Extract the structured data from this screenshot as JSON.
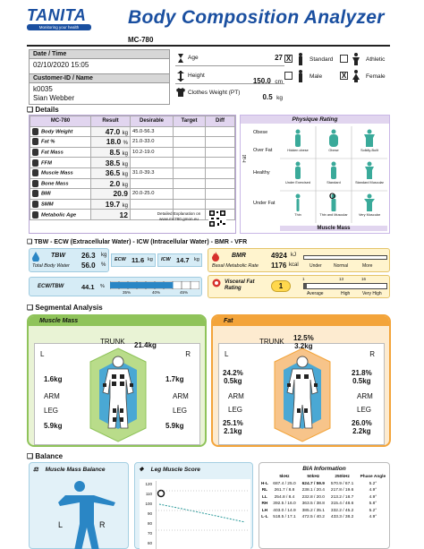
{
  "header": {
    "logo": "TANITA",
    "logo_tag": "Monitoring your health",
    "title": "Body Composition Analyzer",
    "model": "MC-780"
  },
  "info": {
    "date_label": "Date / Time",
    "date_value": "02/10/2020 15:05",
    "customer_label": "Customer-ID / Name",
    "customer_id": "k0035",
    "customer_name": "Sian Webber",
    "age_label": "Age",
    "age_value": "27",
    "height_label": "Height",
    "height_value": "150.0",
    "height_unit": "cm",
    "clothes_label": "Clothes Weight (PT)",
    "clothes_value": "0.5",
    "clothes_unit": "kg",
    "standard_label": "Standard",
    "athletic_label": "Athletic",
    "male_label": "Male",
    "female_label": "Female",
    "standard_checked": "X",
    "female_checked": "X"
  },
  "details": {
    "section_title": "Details",
    "col_model": "MC-780",
    "col_result": "Result",
    "col_desirable": "Desirable",
    "col_target": "Target",
    "col_diff": "Diff",
    "rows": [
      {
        "label": "Body Weight",
        "value": "47.0",
        "unit": "kg",
        "desirable": "45.0-56.3"
      },
      {
        "label": "Fat %",
        "value": "18.0",
        "unit": "%",
        "desirable": "21.0-33.0"
      },
      {
        "label": "Fat Mass",
        "value": "8.5",
        "unit": "kg",
        "desirable": "10.2-19.0"
      },
      {
        "label": "FFM",
        "value": "38.5",
        "unit": "kg",
        "desirable": ""
      },
      {
        "label": "Muscle Mass",
        "value": "36.5",
        "unit": "kg",
        "desirable": "31.0-39.3"
      },
      {
        "label": "Bone Mass",
        "value": "2.0",
        "unit": "kg",
        "desirable": ""
      },
      {
        "label": "BMI",
        "value": "20.9",
        "unit": "",
        "desirable": "20.0-25.0"
      },
      {
        "label": "SMM",
        "value": "19.7",
        "unit": "kg",
        "desirable": ""
      },
      {
        "label": "Metabolic Age",
        "value": "12",
        "unit": "",
        "desirable": ""
      }
    ],
    "explanation": "Detailed Explanation on www.mc780.gmon.eu"
  },
  "physique": {
    "title": "Physique Rating",
    "y_label": "Fat",
    "x_label": "Muscle Mass",
    "rows": [
      "Obese",
      "Over Fat",
      "Healthy",
      "Under Fat"
    ],
    "cells": [
      [
        "Hidden obese",
        "Obese",
        "Solidly-Built"
      ],
      [
        "Under Exercised",
        "Standard",
        "Standard Muscular"
      ],
      [
        "Thin",
        "Thin and Muscular",
        "Very Muscular"
      ]
    ],
    "marker": "O"
  },
  "water": {
    "section_title": "TBW - ECW (Extracellular Water) - ICW (Intracellular Water) - BMR - VFR",
    "tbw_label": "TBW",
    "tbw_value": "26.3",
    "tbw_unit": "kg",
    "tbw_pct_label": "Total Body Water",
    "tbw_pct": "56.0",
    "tbw_pct_unit": "%",
    "ecw_label": "ECW",
    "ecw_value": "11.6",
    "ecw_unit": "kg",
    "icw_label": "ICW",
    "icw_value": "14.7",
    "icw_unit": "kg",
    "ratio_label": "ECW/TBW",
    "ratio_value": "44.1",
    "ratio_unit": "%",
    "ratio_ticks": [
      "35%",
      "40%",
      "45%"
    ],
    "bmr_label": "BMR",
    "bmr_kj": "4924",
    "bmr_kj_unit": "kJ",
    "bmr_sub": "Basal Metabolic Rate",
    "bmr_kcal": "1176",
    "bmr_kcal_unit": "kcal",
    "bmr_scale": [
      "Under",
      "Normal",
      "More"
    ],
    "vfr_label": "Visceral Fat Rating",
    "vfr_value": "1",
    "vfr_ticks": [
      "1",
      "13",
      "16"
    ],
    "vfr_scale": [
      "Average",
      "High",
      "Very High"
    ]
  },
  "segmental": {
    "section_title": "Segmental Analysis",
    "muscle_title": "Muscle Mass",
    "fat_title": "Fat",
    "trunk_label": "TRUNK",
    "arm_label": "ARM",
    "leg_label": "LEG",
    "left_label": "L",
    "right_label": "R",
    "muscle": {
      "trunk": "21.4kg",
      "left_arm": "1.6kg",
      "right_arm": "1.7kg",
      "left_leg": "5.9kg",
      "right_leg": "5.9kg"
    },
    "fat": {
      "trunk_pct": "12.5%",
      "trunk_kg": "3.2kg",
      "left_arm_pct": "24.2%",
      "left_arm_kg": "0.5kg",
      "right_arm_pct": "21.8%",
      "right_arm_kg": "0.5kg",
      "left_leg_pct": "25.1%",
      "left_leg_kg": "2.1kg",
      "right_leg_pct": "26.0%",
      "right_leg_kg": "2.2kg"
    }
  },
  "balance": {
    "section_title": "Balance",
    "mmb_title": "Muscle Mass Balance",
    "lms_title": "Leg Muscle Score",
    "left_label": "L",
    "right_label": "R",
    "lms_yticks": [
      "120",
      "110",
      "100",
      "90",
      "80",
      "70",
      "60"
    ],
    "bia_title": "BIA Information",
    "bia_headers": [
      "",
      "5kHz",
      "50kHz",
      "250kHz",
      "Phase Angle"
    ],
    "bia_rows": [
      [
        "H-L",
        "687.4 / 25.0",
        "624.7 / 59.9",
        "570.9 / 67.1",
        "5.2°"
      ],
      [
        "RL",
        "261.7 / 8.8",
        "238.1 / 20.4",
        "217.8 / 19.6",
        "4.9°"
      ],
      [
        "LL",
        "254.8 / 8.4",
        "232.8 / 20.0",
        "213.2 / 18.7",
        "4.9°"
      ],
      [
        "RH",
        "392.5 / 16.0",
        "363.5 / 38.8",
        "315.4 / 48.6",
        "5.8°"
      ],
      [
        "LH",
        "403.0 / 14.9",
        "385.2 / 35.1",
        "332.2 / 45.2",
        "5.2°"
      ],
      [
        "L-L",
        "518.5 / 17.1",
        "472.5 / 40.2",
        "433.3 / 38.2",
        "4.9°"
      ]
    ]
  }
}
